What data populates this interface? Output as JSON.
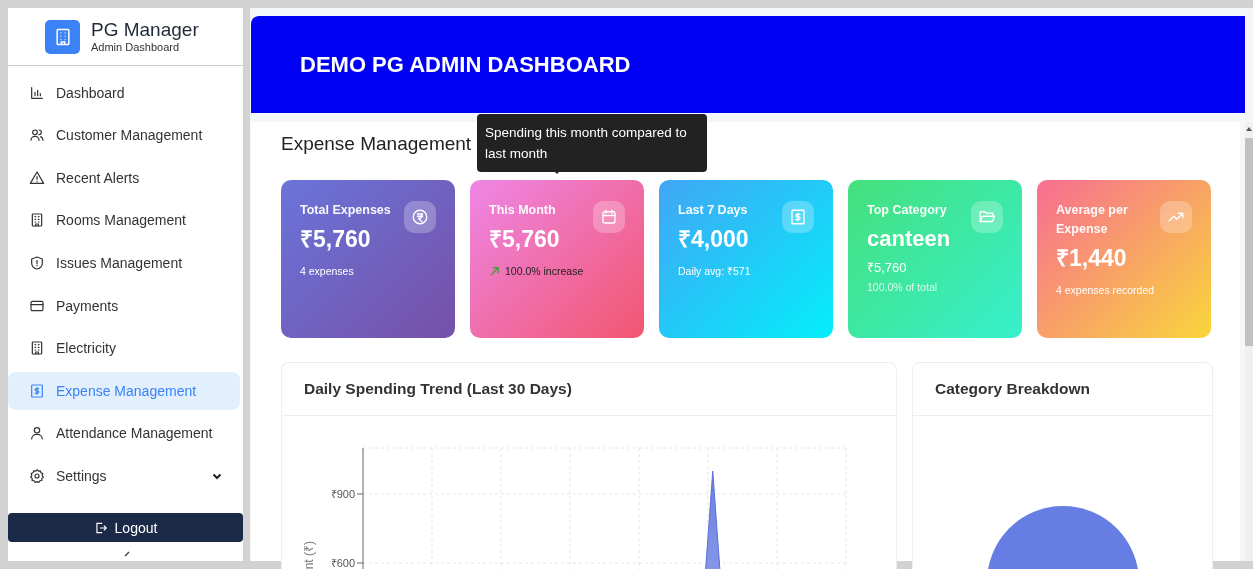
{
  "sidebar": {
    "app_name": "PG Manager",
    "app_subtitle": "Admin Dashboard",
    "items": [
      {
        "label": "Dashboard",
        "kind": "chart",
        "selected": false,
        "expandable": false
      },
      {
        "label": "Customer Management",
        "kind": "users",
        "selected": false,
        "expandable": false
      },
      {
        "label": "Recent Alerts",
        "kind": "alert",
        "selected": false,
        "expandable": false
      },
      {
        "label": "Rooms Management",
        "kind": "building",
        "selected": false,
        "expandable": false
      },
      {
        "label": "Issues Management",
        "kind": "shield",
        "selected": false,
        "expandable": false
      },
      {
        "label": "Payments",
        "kind": "card",
        "selected": false,
        "expandable": false
      },
      {
        "label": "Electricity",
        "kind": "building",
        "selected": false,
        "expandable": false
      },
      {
        "label": "Expense Management",
        "kind": "receipt",
        "selected": true,
        "expandable": false
      },
      {
        "label": "Attendance Management",
        "kind": "user",
        "selected": false,
        "expandable": false
      },
      {
        "label": "Settings",
        "kind": "gear",
        "selected": false,
        "expandable": true
      }
    ],
    "logout": "Logout"
  },
  "header": {
    "title": "DEMO PG ADMIN DASHBOARD"
  },
  "page": {
    "heading": "Expense Management",
    "tooltip": {
      "text": "Spending this month compared to last month"
    },
    "stat_cards": [
      {
        "kind": "total",
        "label": "Total Expenses",
        "value": "₹5,760",
        "note": "4 expenses"
      },
      {
        "kind": "month",
        "label": "This Month",
        "value": "₹5,760",
        "note": "100.0% increase",
        "rising": true
      },
      {
        "kind": "week",
        "label": "Last 7 Days",
        "value": "₹4,000",
        "note": "Daily avg: ₹571"
      },
      {
        "kind": "category",
        "label": "Top Category",
        "value": "canteen",
        "amount": "₹5,760",
        "note": "100.0% of total"
      },
      {
        "kind": "average",
        "label": "Average per Expense",
        "value": "₹1,440",
        "note": "4 expenses recorded"
      }
    ],
    "trend_panel": {
      "chart_data": {
        "type": "area",
        "title": "Daily Spending Trend (Last 30 Days)",
        "ylabel": "nt (₹)",
        "ylim": [
          0,
          1100
        ],
        "yticks": [
          {
            "value": 600,
            "label": "₹600"
          },
          {
            "value": 900,
            "label": "₹900"
          }
        ],
        "values": [
          0,
          0,
          0,
          0,
          0,
          0,
          0,
          0,
          0,
          0,
          0,
          0,
          0,
          0,
          0,
          0,
          0,
          0,
          0,
          0,
          0,
          1000,
          0,
          0,
          0,
          0,
          0,
          0,
          0,
          0
        ]
      }
    },
    "category_panel": {
      "title": "Category Breakdown"
    }
  }
}
